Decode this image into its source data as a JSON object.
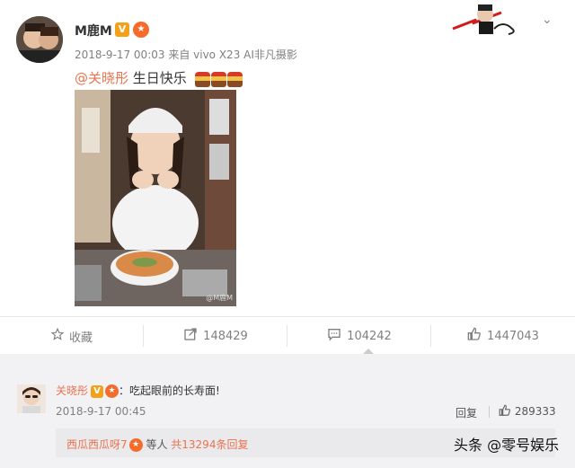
{
  "post": {
    "username": "M鹿M",
    "v_badge": "V",
    "timestamp": "2018-9-17 00:03",
    "source": "来自 vivo X23 AI非凡摄影",
    "mention": "@关晓彤",
    "text": "生日快乐",
    "photo_watermark": "@M鹿M"
  },
  "actions": {
    "favorite": "收藏",
    "repost": "148429",
    "comment": "104242",
    "like": "1447043"
  },
  "comment": {
    "username": "关晓彤",
    "v_badge": "V",
    "text": "：吃起眼前的长寿面!",
    "timestamp": "2018-9-17 00:45",
    "reply_label": "回复",
    "likes": "289333"
  },
  "reply_summary": {
    "user": "西瓜西瓜呀7",
    "middle": " 等人 ",
    "count_text": "共13294条回复"
  },
  "watermark": "头条 @零号娱乐",
  "colors": {
    "accent": "#eb7350",
    "badge_gold": "#f2a11a"
  }
}
